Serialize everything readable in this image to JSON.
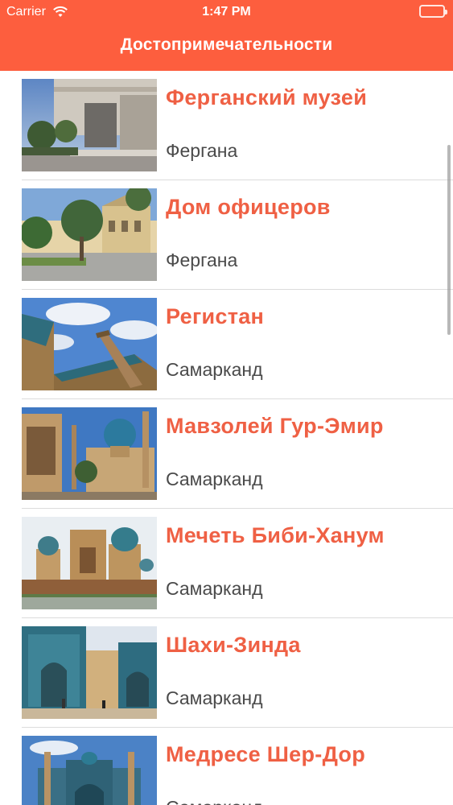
{
  "status_bar": {
    "carrier": "Carrier",
    "time": "1:47 PM",
    "icons": [
      "wifi-icon",
      "battery-icon"
    ]
  },
  "nav": {
    "title": "Достопримечательности",
    "color": "#fd5e3e"
  },
  "places": [
    {
      "title": "Ферганский музей",
      "city": "Фергана"
    },
    {
      "title": "Дом офицеров",
      "city": "Фергана"
    },
    {
      "title": "Регистан",
      "city": "Самарканд"
    },
    {
      "title": "Мавзолей Гур-Эмир",
      "city": "Самарканд"
    },
    {
      "title": "Мечеть Биби-Ханум",
      "city": "Самарканд"
    },
    {
      "title": "Шахи-Зинда",
      "city": "Самарканд"
    },
    {
      "title": "Медресе Шер-Дор",
      "city": "Самарканд"
    }
  ],
  "colors": {
    "title_accent": "#ef6044",
    "city_text": "#4a4a4a",
    "separator": "#dcdcdc"
  }
}
